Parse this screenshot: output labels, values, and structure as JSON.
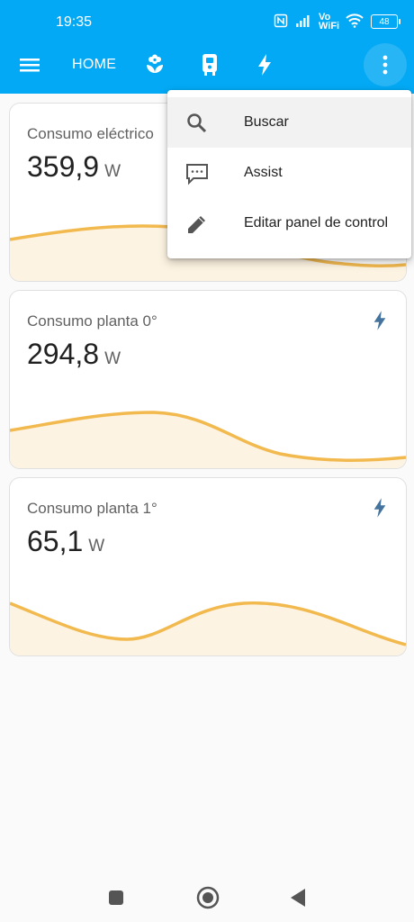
{
  "status_bar": {
    "time": "19:35",
    "network_text": "Vo WiFi",
    "battery": "48"
  },
  "toolbar": {
    "menu_icon": "hamburger-icon",
    "home_label": "HOME",
    "tab_icons": [
      "flower-icon",
      "device-icon",
      "flash-icon"
    ],
    "overflow_icon": "more-vertical-icon"
  },
  "cards": [
    {
      "title": "Consumo eléctrico",
      "value": "359,9",
      "unit": "W",
      "icon": "flash-icon"
    },
    {
      "title": "Consumo planta 0°",
      "value": "294,8",
      "unit": "W",
      "icon": "flash-icon"
    },
    {
      "title": "Consumo planta 1°",
      "value": "65,1",
      "unit": "W",
      "icon": "flash-icon"
    }
  ],
  "menu": {
    "items": [
      {
        "label": "Buscar",
        "icon": "search-icon"
      },
      {
        "label": "Assist",
        "icon": "chat-icon"
      },
      {
        "label": "Editar panel de control",
        "icon": "pencil-icon"
      }
    ]
  },
  "colors": {
    "appbar": "#03a9f4",
    "graph_line": "#f2b94f",
    "graph_fill": "#fdf3e2",
    "icon_blue": "#44739e"
  }
}
